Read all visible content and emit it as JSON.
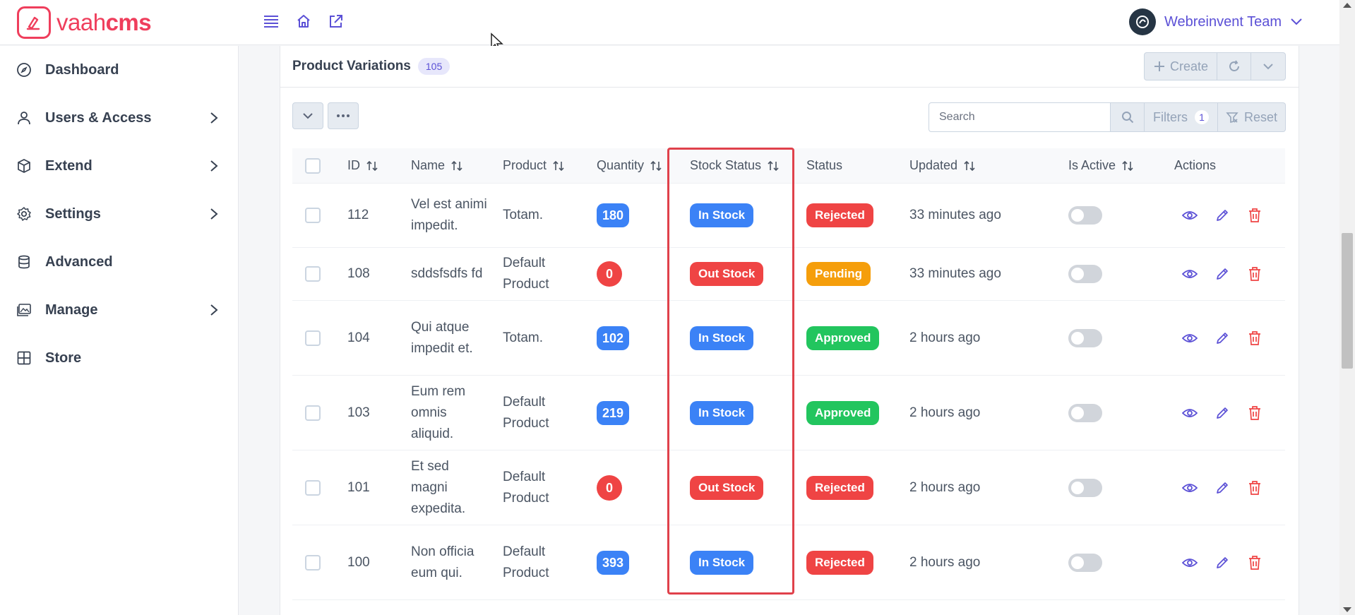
{
  "app": {
    "logo_light": "vaah",
    "logo_bold": "cms"
  },
  "user": {
    "name": "Webreinvent Team"
  },
  "sidebar": {
    "items": [
      {
        "label": "Dashboard",
        "icon": "compass-icon",
        "has_submenu": false
      },
      {
        "label": "Users & Access",
        "icon": "user-icon",
        "has_submenu": true
      },
      {
        "label": "Extend",
        "icon": "box-icon",
        "has_submenu": true
      },
      {
        "label": "Settings",
        "icon": "gear-icon",
        "has_submenu": true
      },
      {
        "label": "Advanced",
        "icon": "database-icon",
        "has_submenu": false
      },
      {
        "label": "Manage",
        "icon": "images-icon",
        "has_submenu": true
      },
      {
        "label": "Store",
        "icon": "table-icon",
        "has_submenu": false
      }
    ]
  },
  "panel": {
    "title": "Product Variations",
    "count": "105",
    "create_label": "Create"
  },
  "search": {
    "placeholder": "Search",
    "value": ""
  },
  "filters": {
    "label": "Filters",
    "count": "1",
    "reset_label": "Reset"
  },
  "table": {
    "columns": [
      "ID",
      "Name",
      "Product",
      "Quantity",
      "Stock Status",
      "Status",
      "Updated",
      "Is Active",
      "Actions"
    ],
    "rows": [
      {
        "id": "112",
        "name": "Vel est animi impedit.",
        "product": "Totam.",
        "quantity": "180",
        "stock": "In Stock",
        "status": "Rejected",
        "updated": "33 minutes ago"
      },
      {
        "id": "108",
        "name": "sddsfsdfs fd",
        "product": "Default Product",
        "quantity": "0",
        "stock": "Out Stock",
        "status": "Pending",
        "updated": "33 minutes ago"
      },
      {
        "id": "104",
        "name": "Qui atque impedit et.",
        "product": "Totam.",
        "quantity": "102",
        "stock": "In Stock",
        "status": "Approved",
        "updated": "2 hours ago"
      },
      {
        "id": "103",
        "name": "Eum rem omnis aliquid.",
        "product": "Default Product",
        "quantity": "219",
        "stock": "In Stock",
        "status": "Approved",
        "updated": "2 hours ago"
      },
      {
        "id": "101",
        "name": "Et sed magni expedita.",
        "product": "Default Product",
        "quantity": "0",
        "stock": "Out Stock",
        "status": "Rejected",
        "updated": "2 hours ago"
      },
      {
        "id": "100",
        "name": "Non officia eum qui.",
        "product": "Default Product",
        "quantity": "393",
        "stock": "In Stock",
        "status": "Rejected",
        "updated": "2 hours ago"
      }
    ]
  },
  "colors": {
    "brand": "#ef3e5c",
    "accent": "#5b50d6",
    "in_stock": "#3b82f6",
    "out_stock": "#ef4444",
    "rejected": "#ef4444",
    "pending": "#f59e0b",
    "approved": "#22c55e",
    "highlight_box": "#e0414b"
  }
}
